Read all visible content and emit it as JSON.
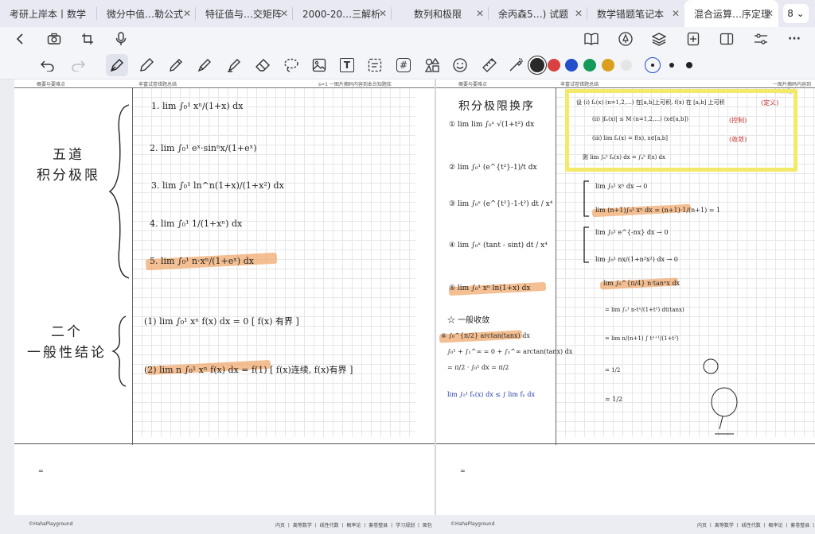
{
  "tabs": [
    {
      "label": "考研上岸本丨数学",
      "active": false
    },
    {
      "label": "微分中值…勒公式",
      "active": false
    },
    {
      "label": "特征值与…交矩阵",
      "active": false
    },
    {
      "label": "2000-20…三解析",
      "active": false
    },
    {
      "label": "数列和极限",
      "active": false
    },
    {
      "label": "余丙森5…) 试题",
      "active": false
    },
    {
      "label": "数学错题笔记本",
      "active": false
    },
    {
      "label": "混合运算…序定理",
      "active": true
    }
  ],
  "tab_close_glyph": "✕",
  "tab_count": "8 ⌄",
  "toolbar": {
    "left_icons": [
      "back-icon",
      "camera-icon",
      "crop-icon",
      "microphone-icon"
    ],
    "right_icons": [
      "book-icon",
      "pen-circle-icon",
      "layers-icon",
      "add-page-icon",
      "sidebar-icon",
      "sliders-icon",
      "more-icon"
    ],
    "more_glyph": "···"
  },
  "pen_toolbar": {
    "tools": [
      "undo-icon",
      "redo-icon",
      "fountain-pen-icon",
      "pen-icon",
      "pencil-icon",
      "marker-icon",
      "highlighter-icon",
      "eraser-icon",
      "lasso-icon",
      "image-icon",
      "text-box-icon",
      "sticky-note-icon",
      "hashtag-icon",
      "shapes-icon",
      "emoji-icon",
      "ruler-icon",
      "laser-icon"
    ],
    "text_tool_glyph": "T",
    "hash_glyph": "#",
    "colors": [
      "#2a2a2a",
      "#d94040",
      "#2350c8",
      "#169a5a",
      "#d9a020",
      "#d6d6d6"
    ],
    "sizes": [
      "small",
      "medium",
      "large"
    ]
  },
  "left_page": {
    "header_left": "概要与要难点",
    "header_mid": "丰富试卷错题总结",
    "header_right": "s=1   一图片摘码内容到本台知题库",
    "title1": "五道\n积分极限",
    "title2": "二个\n一般性结论",
    "items": [
      "1.  lim ∫₀¹ xⁿ/(1+x) dx",
      "2.  lim ∫₀¹ eˣ·sinⁿx/(1+eˣ)",
      "3.  lim ∫₀¹ ln^n(1+x)/(1+x²) dx",
      "4.  lim ∫₀¹ 1/(1+xⁿ) dx",
      "5.  lim ∫₀¹ n·xⁿ/(1+eˣ) dx",
      "(1)  lim ∫₀¹ xⁿ f(x) dx = 0      [ f(x) 有界 ]",
      "(2)  lim n ∫₀¹ xⁿ f(x) dx = f(1)     [ f(x)连续, f(x)有界 ]"
    ],
    "footer_brand": "©HahaPlayground",
    "footer_links": "内页 丨 离等数学 丨 线性代数 丨 概率论 丨 套卷整县 丨 学习规划 丨 图包"
  },
  "right_page": {
    "header_left": "概要与要难点",
    "header_mid": "丰富试卷错题总结",
    "header_right": "一图片摘码内容到本台知题库",
    "title": "积分极限换序",
    "left_items": [
      "①  lim lim ∫₀ˣ √(1+t²) dx",
      "②  lim ∫₀¹ (e^{t²}-1)/t dx",
      "③  lim ∫₀ˣ (e^{t²}-1-t²) dt / x⁴",
      "④  lim ∫₀ˣ (tant - sint) dt / x⁴",
      "⑤  lim ∫₀¹ xⁿ ln(1+x) dx",
      "☆ 一般收敛",
      "⑥  ∫₀^{π/2} arctan(tanx) dx",
      "∫₀¹ + ∫₁^∞ = 0 + ∫₁^∞ arctan(tanx) dx",
      "= π/2 · ∫₀¹ dx = π/2",
      "lim ∫₀¹ fₙ(x) dx ≤ ∫ lim fₙ dx"
    ],
    "box_lines": [
      "设 (i)  fₙ(x) (n=1,2,…) 在[a,b]上可积, f(x) 在 [a,b] 上可积",
      "(ii) |fₙ(x)| ≤ M   (n=1,2,…)  (x∈[a,b])",
      "(iii) lim fₙ(x) = f(x),  x∈[a,b]",
      "则  lim ∫ₐᵇ fₙ(x) dx = ∫ₐᵇ f(x) dx"
    ],
    "box_notes": [
      "(定义)",
      "(控制)",
      "(收敛)"
    ],
    "right_items": [
      "lim ∫₀¹ xⁿ dx  → 0",
      "lim (n+1)∫₀¹ xⁿ dx = (n+1)·1/(n+1) = 1",
      "lim ∫₀¹ e^{-nx} dx  → 0",
      "lim ∫₀¹ nx/(1+n²x²) dx  → 0",
      "lim ∫₀^{π/4} n·tanⁿx dx",
      "= lim ∫₀¹ n·tⁿ/(1+t²) dt(tanx)",
      "= lim n/(n+1) ∫ tⁿ⁺¹/(1+t²)",
      "= 1/2",
      "= 1/2"
    ],
    "footer_brand": "©HahaPlayground",
    "footer_links": "内页 丨 离等数学 丨 线性代数 丨 概率论 丨 套卷整县 丨 学习规划 丨 图包"
  }
}
